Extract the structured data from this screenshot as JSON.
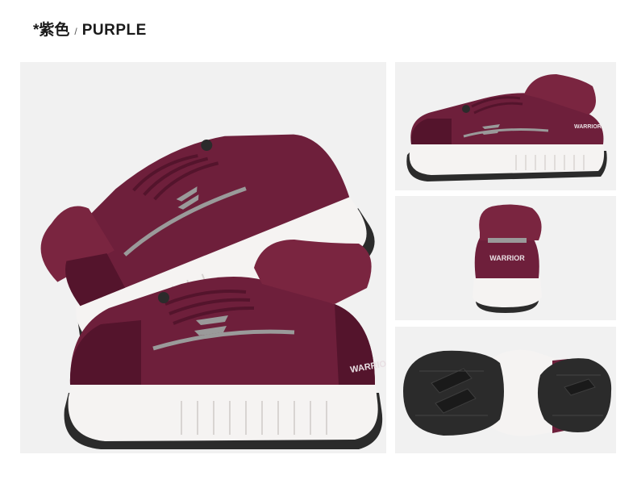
{
  "header": {
    "title_cn": "*紫色",
    "separator": "/",
    "title_en": "PURPLE"
  },
  "colors": {
    "shoe_main": "#6e1f3b",
    "shoe_dark": "#54142c",
    "fur": "#7a2540",
    "sole": "#f5f3f2",
    "outsole": "#2b2b2b",
    "reflect": "#9a9a9a",
    "background": "#f1f1f1"
  },
  "brand": {
    "logo_text": "WARRIOR"
  },
  "panels": {
    "main": "two-shoes-stacked",
    "side": "side-view",
    "back": "back-view",
    "sole": "outsole-view"
  }
}
